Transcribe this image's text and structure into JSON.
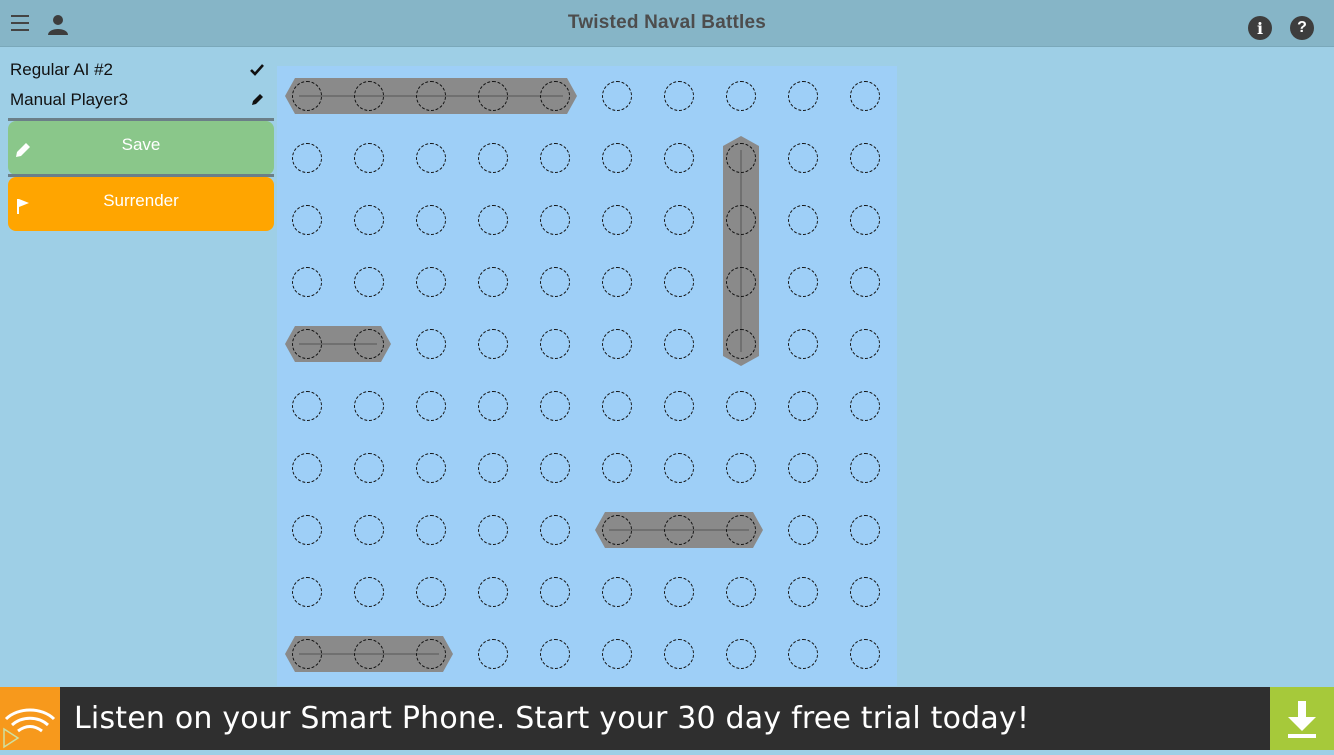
{
  "header": {
    "title": "Twisted Naval Battles",
    "menu_icon": "hamburger-menu-icon",
    "user_icon": "user-icon",
    "info_icon": "info-icon",
    "help_icon": "help-icon",
    "info_glyph": "i",
    "help_glyph": "?"
  },
  "sidebar": {
    "players": [
      {
        "name": "Regular AI #2",
        "status_icon": "checkmark-icon"
      },
      {
        "name": "Manual Player3",
        "status_icon": "pencil-icon"
      }
    ],
    "save_label": "Save",
    "surrender_label": "Surrender"
  },
  "board": {
    "rows": 10,
    "cols": 10,
    "background": "#9ecff7",
    "ship_color": "#8a8a8a",
    "ships": [
      {
        "name": "battleship",
        "orientation": "horizontal",
        "row": 0,
        "col": 0,
        "length": 5
      },
      {
        "name": "cruiser",
        "orientation": "vertical",
        "row": 1,
        "col": 7,
        "length": 4
      },
      {
        "name": "destroyer-top",
        "orientation": "horizontal",
        "row": 4,
        "col": 0,
        "length": 2
      },
      {
        "name": "submarine",
        "orientation": "horizontal",
        "row": 7,
        "col": 5,
        "length": 3
      },
      {
        "name": "frigate",
        "orientation": "horizontal",
        "row": 9,
        "col": 0,
        "length": 3
      }
    ]
  },
  "ad": {
    "text": "Listen on your Smart Phone. Start your 30 day free trial today!",
    "logo_icon": "audible-logo-icon",
    "download_icon": "download-icon",
    "logo_color": "#f7991c",
    "download_color": "#a6c93a"
  }
}
